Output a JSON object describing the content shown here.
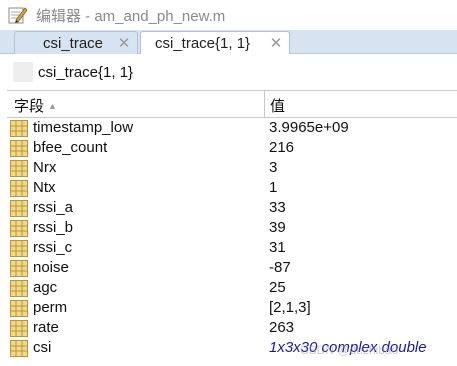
{
  "window": {
    "title": "编辑器 - am_and_ph_new.m",
    "app_icon": "pencil-edit-icon"
  },
  "tabs": [
    {
      "label": "csi_trace",
      "active": false,
      "close_icon": "close-icon"
    },
    {
      "label": "csi_trace{1, 1}",
      "active": true,
      "close_icon": "close-icon"
    }
  ],
  "path_label": "csi_trace{1, 1}",
  "table": {
    "headers": {
      "field": "字段",
      "value": "值",
      "sort_icon": "sort-ascending-icon"
    },
    "rows": [
      {
        "field": "timestamp_low",
        "value": "3.9965e+09"
      },
      {
        "field": "bfee_count",
        "value": "216"
      },
      {
        "field": "Nrx",
        "value": "3"
      },
      {
        "field": "Ntx",
        "value": "1"
      },
      {
        "field": "rssi_a",
        "value": "33"
      },
      {
        "field": "rssi_b",
        "value": "39"
      },
      {
        "field": "rssi_c",
        "value": "31"
      },
      {
        "field": "noise",
        "value": "-87"
      },
      {
        "field": "agc",
        "value": "25"
      },
      {
        "field": "perm",
        "value": "[2,1,3]"
      },
      {
        "field": "rate",
        "value": "263"
      },
      {
        "field": "csi",
        "value": "1x3x30 complex double"
      }
    ]
  },
  "watermark": "CSDN @dezhibao",
  "colors": {
    "tab_strip": "#d7e3f0",
    "field_icon_fill": "#f2d98a",
    "field_icon_stroke": "#b8963a",
    "complex_value": "#1a1aa8"
  }
}
